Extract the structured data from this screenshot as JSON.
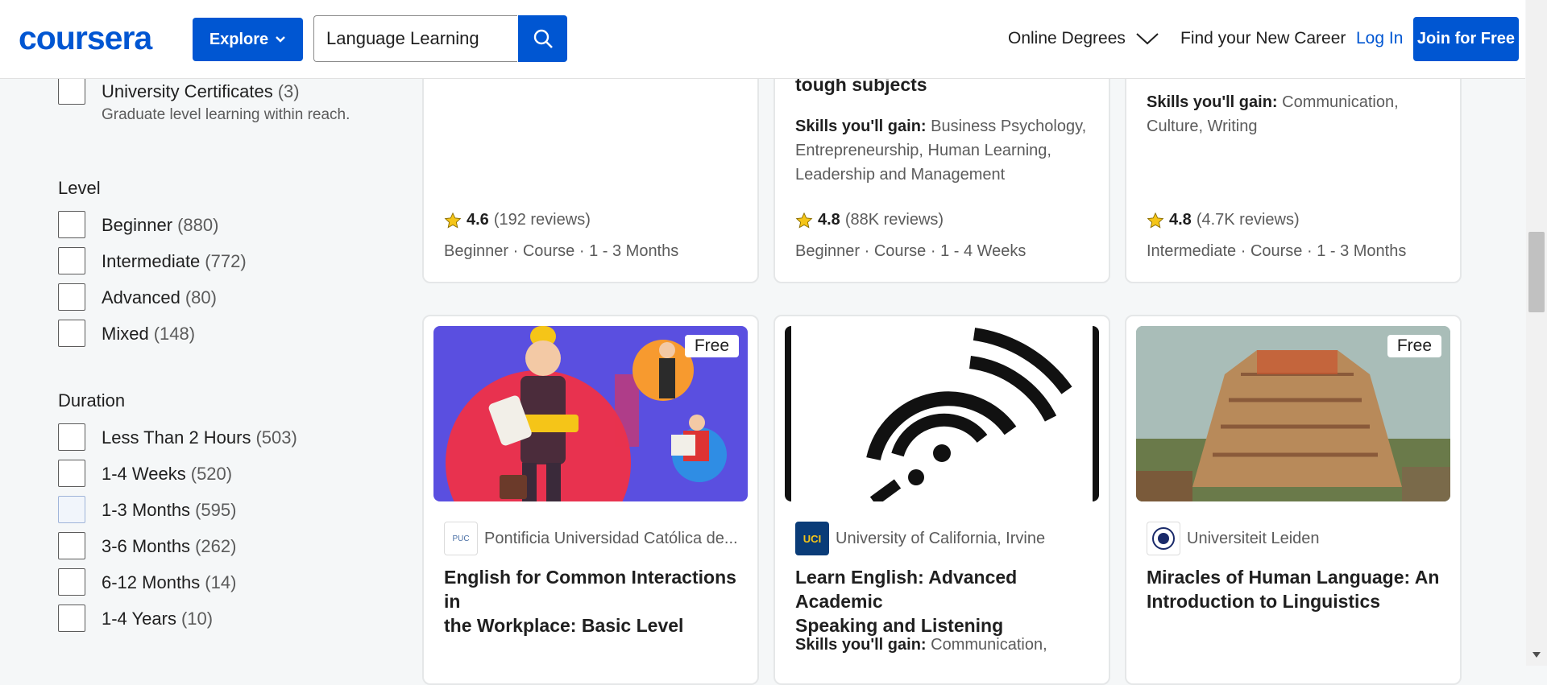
{
  "header": {
    "logo": "coursera",
    "explore_label": "Explore",
    "search_value": "Language Learning",
    "nav_online_degrees": "Online Degrees",
    "nav_find_career": "Find your New Career",
    "login_label": "Log In",
    "join_label": "Join for Free",
    "brand_color": "#0056d2"
  },
  "sidebar": {
    "university_certs": {
      "label": "University Certificates",
      "count": "(3)",
      "subtitle": "Graduate level learning within reach."
    },
    "level": {
      "title": "Level",
      "options": [
        {
          "label": "Beginner",
          "count": "(880)"
        },
        {
          "label": "Intermediate",
          "count": "(772)"
        },
        {
          "label": "Advanced",
          "count": "(80)"
        },
        {
          "label": "Mixed",
          "count": "(148)"
        }
      ]
    },
    "duration": {
      "title": "Duration",
      "options": [
        {
          "label": "Less Than 2 Hours",
          "count": "(503)"
        },
        {
          "label": "1-4 Weeks",
          "count": "(520)"
        },
        {
          "label": "1-3 Months",
          "count": "(595)"
        },
        {
          "label": "3-6 Months",
          "count": "(262)"
        },
        {
          "label": "6-12 Months",
          "count": "(14)"
        },
        {
          "label": "1-4 Years",
          "count": "(10)"
        }
      ]
    }
  },
  "cards_top": [
    {
      "rating": "4.6",
      "reviews": "(192 reviews)",
      "meta": "Beginner · Course · 1 - 3 Months"
    },
    {
      "title_tail": "tough subjects",
      "skills_label": "Skills you'll gain:",
      "skills_line1": " Business Psychology,",
      "skills_line2": "Entrepreneurship, Human Learning,",
      "skills_line3": "Leadership and Management",
      "rating": "4.8",
      "reviews": "(88K reviews)",
      "meta": "Beginner · Course · 1 - 4 Weeks"
    },
    {
      "skills_label": "Skills you'll gain:",
      "skills_line1": " Communication,",
      "skills_line2": "Culture, Writing",
      "rating": "4.8",
      "reviews": "(4.7K reviews)",
      "meta": "Intermediate · Course · 1 - 3 Months"
    }
  ],
  "cards_bottom": [
    {
      "badge": "Free",
      "partner": "Pontificia Universidad Católica de...",
      "partner_logo": "PUC",
      "title_line1": "English for Common Interactions in",
      "title_line2": "the Workplace: Basic Level",
      "image_icon": "construction-worker-illustration"
    },
    {
      "partner": "University of California, Irvine",
      "partner_logo": "UCI",
      "title_line1": "Learn English: Advanced Academic",
      "title_line2": "Speaking and Listening",
      "skills_label": "Skills you'll gain:",
      "skills_line1": " Communication,",
      "image_icon": "listening-signal-icon"
    },
    {
      "badge": "Free",
      "partner": "Universiteit Leiden",
      "partner_logo": "UL",
      "title_line1": "Miracles of Human Language: An",
      "title_line2": "Introduction to Linguistics",
      "image_icon": "tower-of-babel-painting"
    }
  ]
}
